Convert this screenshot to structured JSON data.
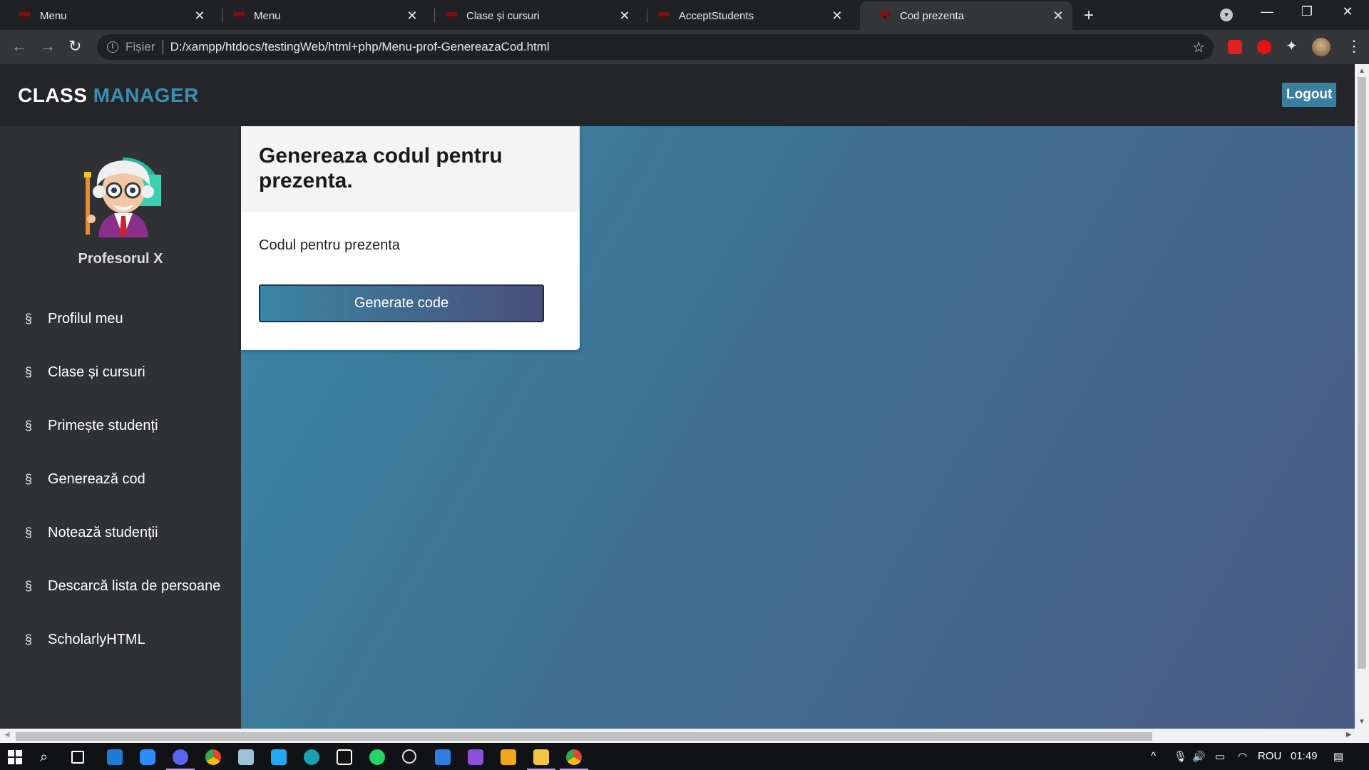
{
  "browser": {
    "tabs": [
      {
        "title": "Menu",
        "active": false
      },
      {
        "title": "Menu",
        "active": false
      },
      {
        "title": "Clase și cursuri",
        "active": false
      },
      {
        "title": "AcceptStudents",
        "active": false
      },
      {
        "title": "Cod prezenta",
        "active": true
      }
    ],
    "close_glyph": "✕",
    "new_tab_glyph": "+",
    "address": {
      "scheme_label": "Fișier",
      "url": "D:/xampp/htdocs/testingWeb/html+php/Menu-prof-GenereazaCod.html"
    },
    "icons": {
      "back": "arrow-left-icon",
      "forward": "arrow-right-icon",
      "reload": "reload-icon",
      "info": "info-icon",
      "bookmark": "star-icon",
      "extensions": "puzzle-icon",
      "menu": "kebab-menu-icon"
    }
  },
  "header": {
    "brand_part1": "CLASS",
    "brand_part2": "MANAGER",
    "logout_label": "Logout",
    "colors": {
      "brand_accent": "#3a8eb0",
      "topbar": "#232529",
      "logout_bg": "#3a7fa0"
    }
  },
  "sidebar": {
    "profile_name": "Profesorul X",
    "nav_icon_glyph": "§",
    "items": [
      {
        "label": "Profilul meu"
      },
      {
        "label": "Clase și cursuri"
      },
      {
        "label": "Primește studenți"
      },
      {
        "label": "Generează cod"
      },
      {
        "label": "Notează studenții"
      },
      {
        "label": "Descarcă lista de persoane"
      },
      {
        "label": "ScholarlyHTML"
      }
    ]
  },
  "main": {
    "card_title": "Genereaza codul pentru prezenta.",
    "code_label": "Codul pentru prezenta",
    "generate_button_label": "Generate code",
    "colors": {
      "gradient_start": "#3a88a8",
      "gradient_end": "#4b5b84"
    }
  },
  "taskbar": {
    "language": "ROU",
    "time": "01:49"
  }
}
